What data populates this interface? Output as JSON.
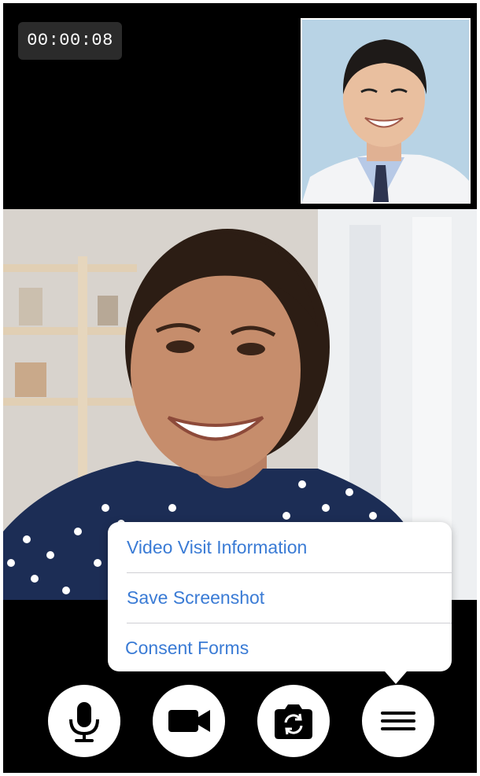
{
  "call": {
    "elapsed_time": "00:00:08"
  },
  "menu": {
    "items": [
      {
        "label": "Video Visit Information"
      },
      {
        "label": "Save Screenshot"
      },
      {
        "label": "Consent Forms"
      }
    ]
  },
  "controls": [
    {
      "icon": "microphone-icon"
    },
    {
      "icon": "video-camera-icon"
    },
    {
      "icon": "switch-camera-icon"
    },
    {
      "icon": "menu-icon"
    }
  ],
  "colors": {
    "menu_text": "#3a7bd5",
    "background": "#000000",
    "button": "#ffffff"
  }
}
